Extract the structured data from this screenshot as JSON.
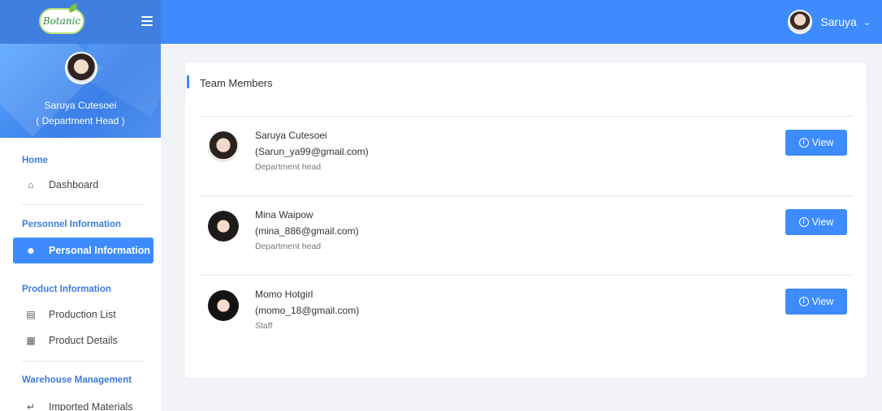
{
  "app": {
    "logo_text": "Botanic"
  },
  "header": {
    "username": "Saruya"
  },
  "sidebar": {
    "profile": {
      "name": "Saruya Cutesoei",
      "role": "( Department Head )"
    },
    "sections": [
      {
        "title": "Home",
        "items": [
          {
            "label": "Dashboard",
            "icon": "home-icon"
          }
        ]
      },
      {
        "title": "Personnel Information",
        "items": [
          {
            "label": "Personal Information",
            "icon": "user-icon",
            "active": true
          }
        ]
      },
      {
        "title": "Product Information",
        "items": [
          {
            "label": "Production List",
            "icon": "list-icon"
          },
          {
            "label": "Product Details",
            "icon": "grid-icon"
          }
        ]
      },
      {
        "title": "Warehouse Management",
        "items": [
          {
            "label": "Imported Materials",
            "icon": "import-icon"
          }
        ]
      }
    ]
  },
  "main": {
    "card_title": "Team Members",
    "view_label": "View",
    "members": [
      {
        "name": "Saruya Cutesoei",
        "email": "(Sarun_ya99@gmail.com)",
        "role": "Department head"
      },
      {
        "name": "Mina Waipow",
        "email": "(mina_886@gmail.com)",
        "role": "Department head"
      },
      {
        "name": "Momo Hotgirl",
        "email": "(momo_18@gmail.com)",
        "role": "Staff"
      }
    ]
  },
  "colors": {
    "primary": "#3d8bfd",
    "section_title": "#3d7be0",
    "page_bg": "#f1f3f6"
  }
}
